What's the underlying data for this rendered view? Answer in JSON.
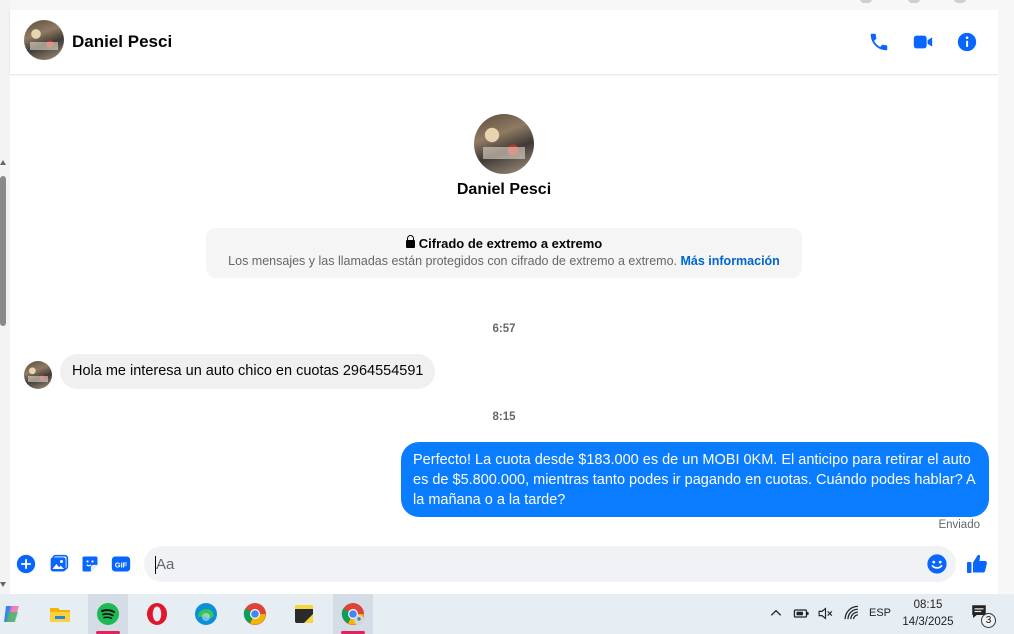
{
  "header": {
    "contact_name": "Daniel Pesci",
    "icons": [
      "phone-icon",
      "video-icon",
      "info-icon"
    ]
  },
  "profile": {
    "name": "Daniel Pesci"
  },
  "encryption": {
    "title": "Cifrado de extremo a extremo",
    "description": "Los mensajes y las llamadas están protegidos con cifrado de extremo a extremo.",
    "link": "Más información"
  },
  "messages": [
    {
      "time": "6:57",
      "direction": "incoming",
      "text": "Hola me interesa un auto chico en cuotas 2964554591"
    },
    {
      "time": "8:15",
      "direction": "outgoing",
      "text": "Perfecto! La cuota desde $183.000 es de un MOBI 0KM. El anticipo para retirar el auto es de $5.800.000, mientras tanto podes ir pagando en cuotas. Cuándo podes hablar? A la mañana o a la tarde?",
      "status": "Enviado"
    }
  ],
  "composer": {
    "placeholder": "Aa",
    "gif_label": "GIF",
    "icons": [
      "add-icon",
      "photo-icon",
      "sticker-icon",
      "gif-icon",
      "emoji-icon",
      "like-icon"
    ]
  },
  "colors": {
    "accent": "#0a7cff",
    "icon_blue": "#0866ff"
  },
  "taskbar": {
    "apps": [
      "copilot-icon",
      "file-explorer-icon",
      "spotify-icon",
      "opera-icon",
      "edge-icon",
      "chrome-icon",
      "sticky-notes-icon",
      "chrome-profile-icon"
    ],
    "language": "ESP",
    "time": "08:15",
    "date": "14/3/2025",
    "notification_count": "3"
  }
}
